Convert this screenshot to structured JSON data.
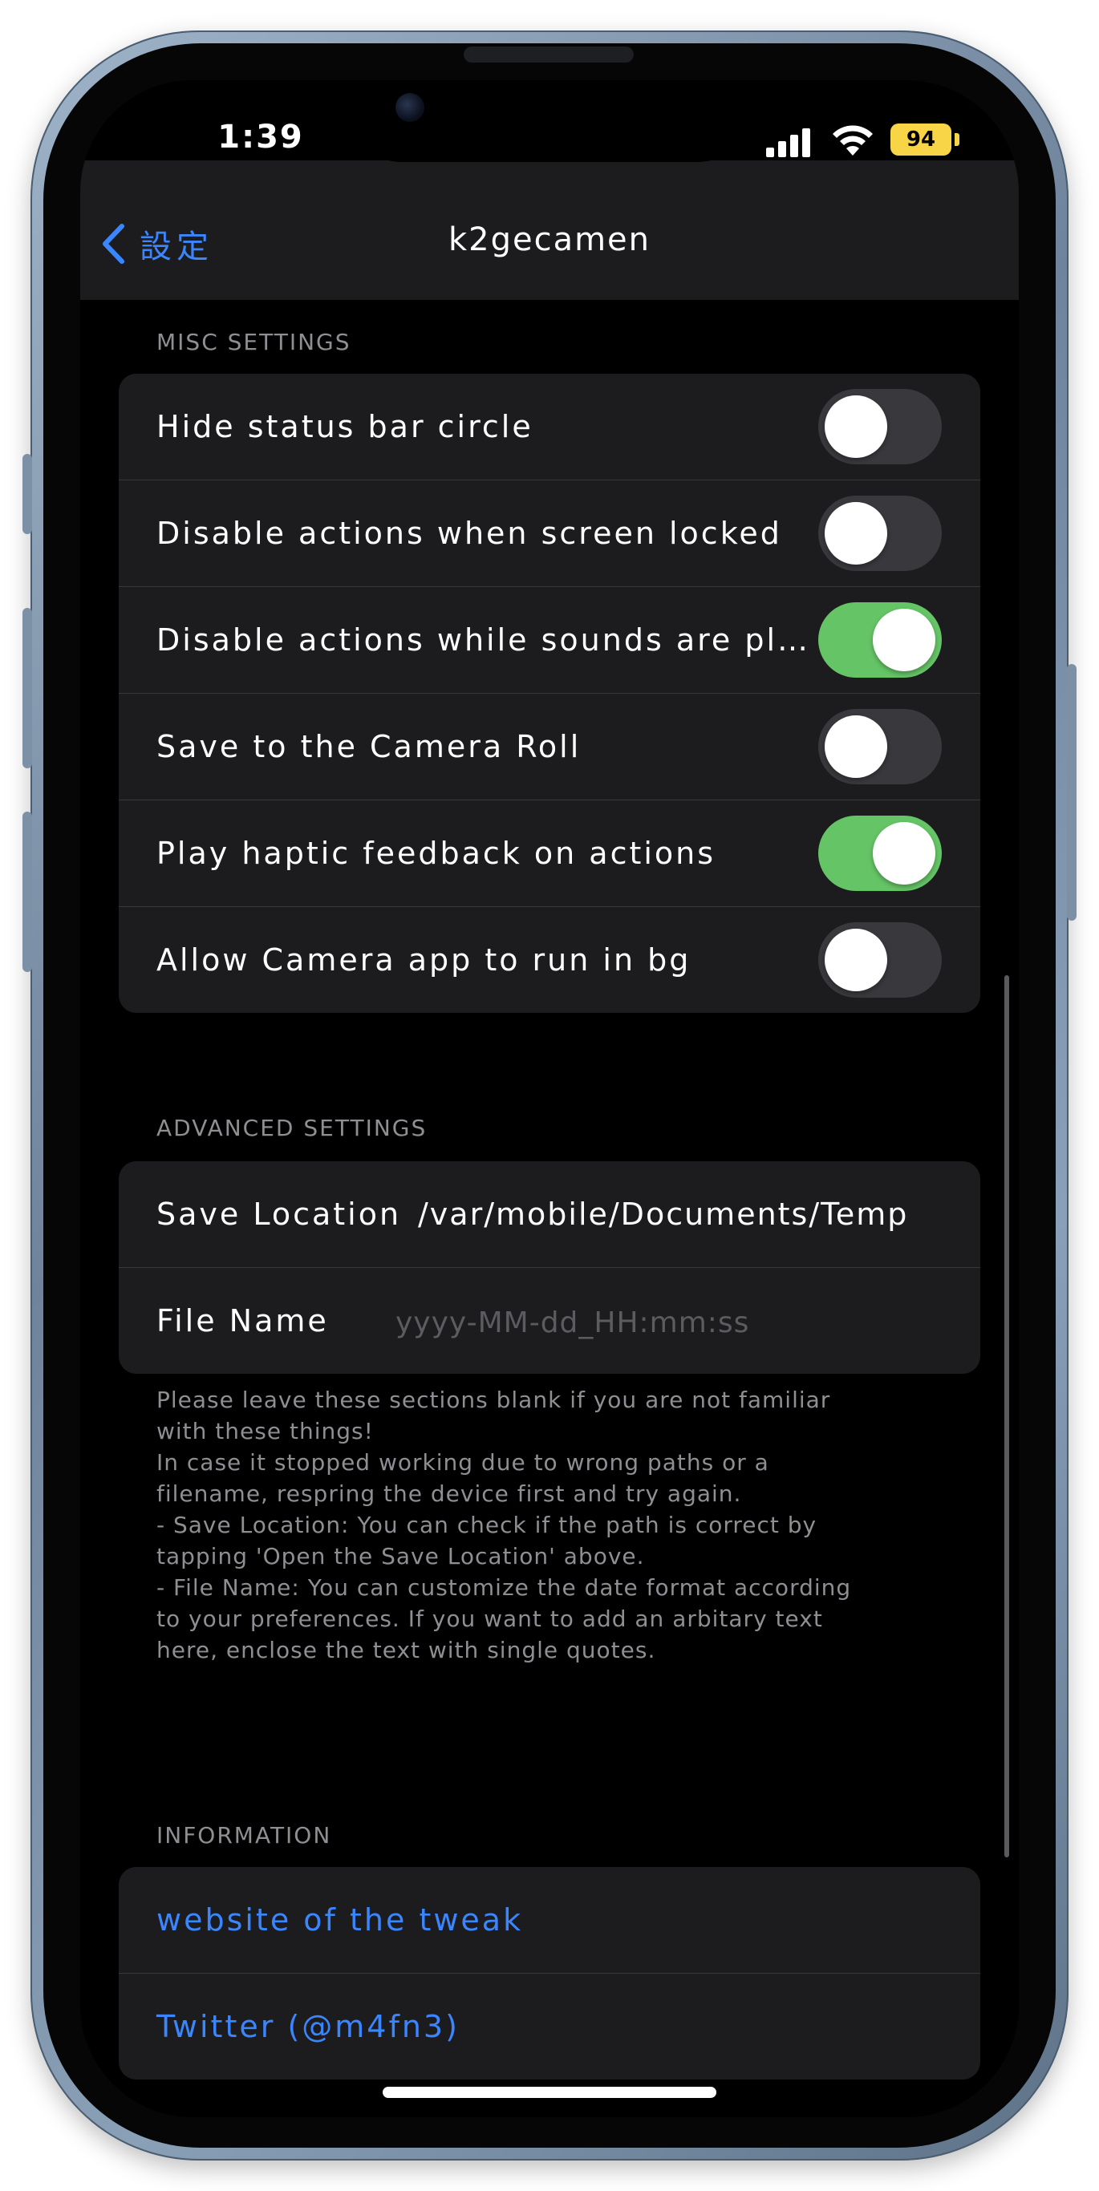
{
  "status": {
    "time": "1:39",
    "battery": "94",
    "charging": true
  },
  "nav": {
    "back_label": "設定",
    "title": "k2gecamen"
  },
  "misc": {
    "header": "MISC SETTINGS",
    "rows": [
      {
        "label": "Hide status bar circle",
        "on": false
      },
      {
        "label": "Disable actions when screen locked",
        "on": false
      },
      {
        "label": "Disable actions while sounds are pla…",
        "on": true
      },
      {
        "label": "Save to the Camera Roll",
        "on": false
      },
      {
        "label": "Play haptic feedback on actions",
        "on": true
      },
      {
        "label": "Allow Camera app to run in bg",
        "on": false
      }
    ]
  },
  "advanced": {
    "header": "ADVANCED SETTINGS",
    "save_location_label": "Save Location",
    "save_location_value": "/var/mobile/Documents/Temp",
    "file_name_label": "File Name",
    "file_name_placeholder": "yyyy-MM-dd_HH:mm:ss",
    "footer": "Please leave these sections blank if you are not familiar\nwith these things!\nIn case it stopped working due to wrong paths or a\nfilename, respring the device first and try again.\n- Save Location: You can check if the path is correct by\ntapping 'Open the Save Location' above.\n- File Name: You can customize the date format according\nto your preferences. If you want to add an arbitary text\nhere, enclose the text with single quotes."
  },
  "information": {
    "header": "INFORMATION",
    "links": [
      "website of the tweak",
      "Twitter (@m4fn3)"
    ]
  },
  "colors": {
    "accent": "#3a86ff",
    "toggle_on": "#65c466",
    "toggle_off": "#39393d",
    "cell_bg": "#1c1c1e",
    "battery": "#f7d547"
  }
}
